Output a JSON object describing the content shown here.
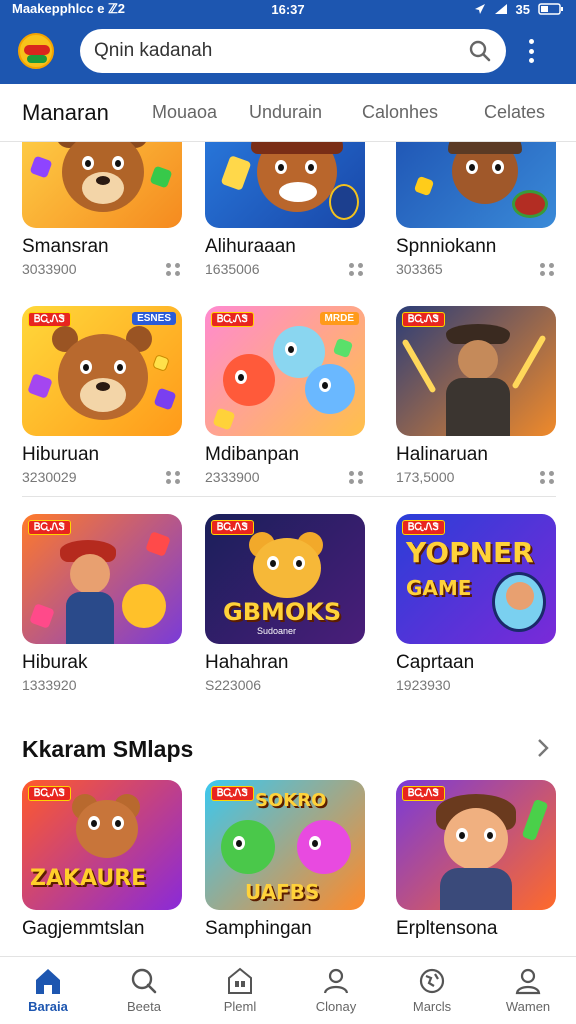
{
  "status_bar": {
    "carrier": "Maakepphlcc  e  ℤ2",
    "time": "16:37",
    "battery": "35"
  },
  "search": {
    "placeholder": "Qnin kadanah"
  },
  "tabs": [
    {
      "label": "Manaran",
      "active": true
    },
    {
      "label": "Mouaoa"
    },
    {
      "label": "Undurain"
    },
    {
      "label": "Calonhes"
    },
    {
      "label": "Celates"
    }
  ],
  "grid": [
    {
      "title": "Smansran",
      "meta": "3033900"
    },
    {
      "title": "Alihuraaan",
      "meta": "1635006"
    },
    {
      "title": "Spnniokann",
      "meta": "303365"
    },
    {
      "title": "Hiburuan",
      "meta": "3230029",
      "badge": "ᏴᏩᏁᏕ",
      "badge2": "ESNES"
    },
    {
      "title": "Mdibanpan",
      "meta": "2333900",
      "badge": "ᏴᏩᏁᏕ",
      "badge2": "MRDE"
    },
    {
      "title": "Halinaruan",
      "meta": "173,5000",
      "badge": "ᏴᏩᏁᏕ"
    },
    {
      "title": "Hiburak",
      "meta": "1333920",
      "badge": "ᏴᏩᏁᏕ"
    },
    {
      "title": "Hahahran",
      "meta": "S223006",
      "badge": "ᏴᏩᏁᏕ",
      "art_text": "GBMOKS",
      "art_sub": "Sudoaner"
    },
    {
      "title": "Caprtaan",
      "meta": "1923930",
      "badge": "ᏴᏩᏁᏕ",
      "art_text": "YOPNER",
      "art_sub": "GAME"
    }
  ],
  "section": {
    "title": "Kkaram SMlaps"
  },
  "section_items": [
    {
      "title": "Gagjemmtslan",
      "meta": "",
      "badge": "ᏴᏩᏁᏕ",
      "art_text": "ZAKAURE"
    },
    {
      "title": "Samphingan",
      "meta": "",
      "badge": "ᏴᏩᏁᏕ",
      "art_text": "SOKRO",
      "art_sub": "UAFBS"
    },
    {
      "title": "Erpltensona",
      "meta": "",
      "badge": "ᏴᏩᏁᏕ"
    }
  ],
  "bottom_nav": [
    {
      "label": "Baraia",
      "icon": "home-icon",
      "active": true
    },
    {
      "label": "Beeta",
      "icon": "search-icon"
    },
    {
      "label": "Pleml",
      "icon": "store-icon"
    },
    {
      "label": "Clonay",
      "icon": "person-icon"
    },
    {
      "label": "Marcls",
      "icon": "globe-icon"
    },
    {
      "label": "Wamen",
      "icon": "profile-icon"
    }
  ],
  "colors": {
    "brand": "#1d56b0",
    "badge": "#e8251f"
  }
}
